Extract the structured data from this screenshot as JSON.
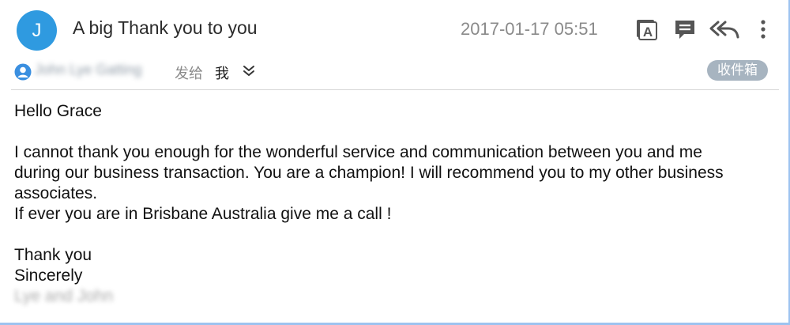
{
  "header": {
    "avatar_letter": "J",
    "subject": "A big Thank you to you",
    "date": "2017-01-17 05:51",
    "toolbar": {
      "translate_icon": "translate-icon",
      "comment_icon": "comment-icon",
      "reply_all_icon": "reply-all-icon",
      "more_icon": "more-vertical-icon"
    }
  },
  "sender_row": {
    "sender_name": "John Lye Gatting",
    "sent_to_label": "发给",
    "recipient": "我",
    "folder": "收件箱"
  },
  "body": {
    "greeting": "Hello Grace",
    "paragraph_lines": [
      "I cannot thank you enough for the wonderful service and communication between you and me",
      "during our business transaction. You are a champion! I will recommend you to my other business",
      "associates.",
      "If ever you are in Brisbane Australia give me a call  !"
    ],
    "closing_1": "Thank you",
    "closing_2": "Sincerely",
    "signature": "Lye and John"
  },
  "colors": {
    "avatar": "#2f9ae0",
    "folder_badge": "#a7b4c0",
    "frame_border": "#9dc3f0"
  }
}
